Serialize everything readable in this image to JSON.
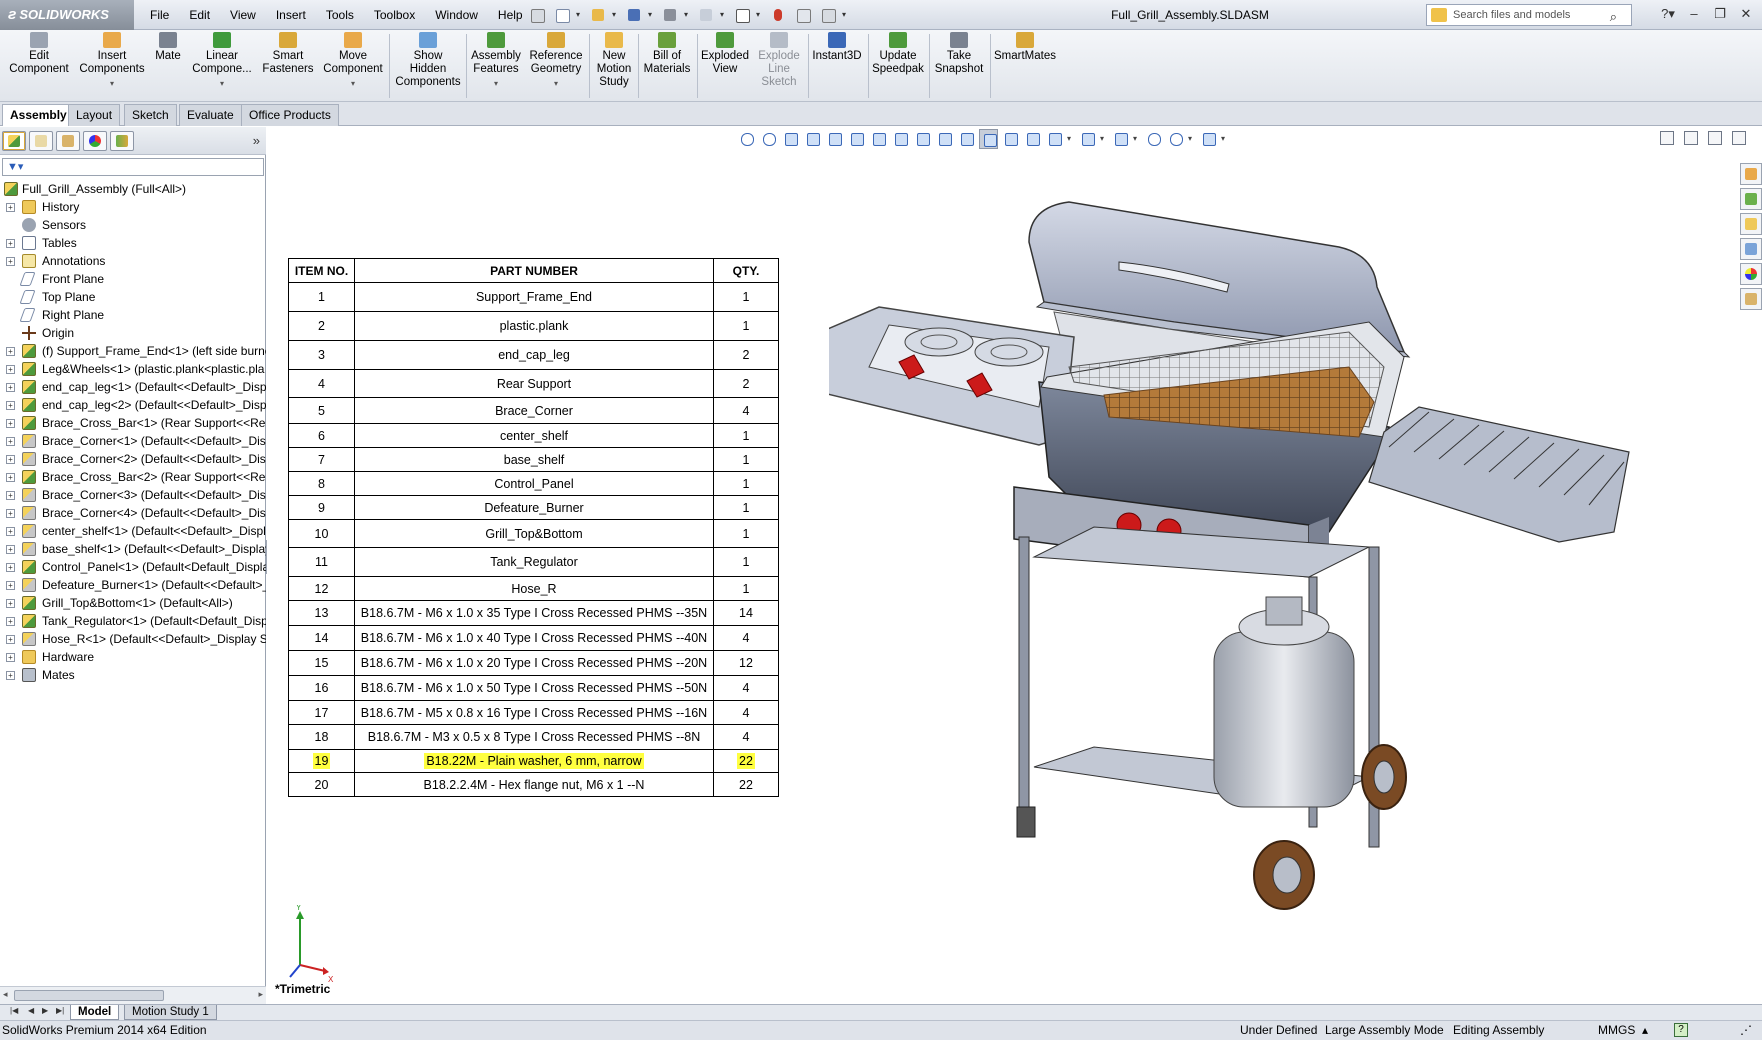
{
  "app": {
    "brand": "SOLIDWORKS",
    "document_title": "Full_Grill_Assembly.SLDASM",
    "search_placeholder": "Search files and models"
  },
  "menu": [
    "File",
    "Edit",
    "View",
    "Insert",
    "Tools",
    "Toolbox",
    "Window",
    "Help"
  ],
  "commands": [
    {
      "id": "edit-component",
      "label1": "Edit",
      "label2": "Component",
      "label3": "",
      "disabled": true,
      "dropdown": false,
      "color": "#9aa3b1"
    },
    {
      "id": "insert-components",
      "label1": "Insert",
      "label2": "Components",
      "label3": "",
      "disabled": false,
      "dropdown": true,
      "color": "#e9a94a"
    },
    {
      "id": "mate",
      "label1": "Mate",
      "label2": "",
      "label3": "",
      "disabled": false,
      "dropdown": false,
      "color": "#7a8290"
    },
    {
      "id": "linear-component",
      "label1": "Linear",
      "label2": "Compone...",
      "label3": "",
      "disabled": false,
      "dropdown": true,
      "color": "#3f9a3c"
    },
    {
      "id": "smart-fasteners",
      "label1": "Smart",
      "label2": "Fasteners",
      "label3": "",
      "disabled": false,
      "dropdown": false,
      "color": "#d9a83a"
    },
    {
      "id": "move-component",
      "label1": "Move",
      "label2": "Component",
      "label3": "",
      "disabled": false,
      "dropdown": true,
      "color": "#e9a94a"
    },
    {
      "id": "show-hidden-components",
      "label1": "Show",
      "label2": "Hidden",
      "label3": "Components",
      "disabled": false,
      "dropdown": false,
      "color": "#6aa0d8"
    },
    {
      "id": "assembly-features",
      "label1": "Assembly",
      "label2": "Features",
      "label3": "",
      "disabled": false,
      "dropdown": true,
      "color": "#4e9a3c"
    },
    {
      "id": "reference-geometry",
      "label1": "Reference",
      "label2": "Geometry",
      "label3": "",
      "disabled": false,
      "dropdown": true,
      "color": "#d9a83a"
    },
    {
      "id": "new-motion-study",
      "label1": "New",
      "label2": "Motion",
      "label3": "Study",
      "disabled": false,
      "dropdown": false,
      "color": "#e9b94a"
    },
    {
      "id": "bill-of-materials",
      "label1": "Bill of",
      "label2": "Materials",
      "label3": "",
      "disabled": false,
      "dropdown": false,
      "color": "#6aa03c"
    },
    {
      "id": "exploded-view",
      "label1": "Exploded",
      "label2": "View",
      "label3": "",
      "disabled": false,
      "dropdown": false,
      "color": "#4e9a3c"
    },
    {
      "id": "explode-line-sketch",
      "label1": "Explode",
      "label2": "Line",
      "label3": "Sketch",
      "disabled": true,
      "dropdown": false,
      "color": "#b5bcc7"
    },
    {
      "id": "instant3d",
      "label1": "Instant3D",
      "label2": "",
      "label3": "",
      "disabled": false,
      "dropdown": false,
      "color": "#3b68b7"
    },
    {
      "id": "update-speedpak",
      "label1": "Update",
      "label2": "Speedpak",
      "label3": "",
      "disabled": false,
      "dropdown": false,
      "color": "#4e9a3c"
    },
    {
      "id": "take-snapshot",
      "label1": "Take",
      "label2": "Snapshot",
      "label3": "",
      "disabled": false,
      "dropdown": false,
      "color": "#7a8290"
    },
    {
      "id": "smartmates",
      "label1": "SmartMates",
      "label2": "",
      "label3": "",
      "disabled": false,
      "dropdown": false,
      "color": "#d9a83a"
    }
  ],
  "tabs": [
    "Assembly",
    "Layout",
    "Sketch",
    "Evaluate",
    "Office Products"
  ],
  "tree": [
    {
      "label": "Full_Grill_Assembly  (Full<All>)",
      "icon": "asm",
      "expander": false,
      "root": true
    },
    {
      "label": "History",
      "icon": "history",
      "expander": true
    },
    {
      "label": "Sensors",
      "icon": "sensor",
      "expander": false
    },
    {
      "label": "Tables",
      "icon": "table",
      "expander": true
    },
    {
      "label": "Annotations",
      "icon": "annot",
      "expander": true
    },
    {
      "label": "Front Plane",
      "icon": "plane",
      "expander": false
    },
    {
      "label": "Top Plane",
      "icon": "plane",
      "expander": false
    },
    {
      "label": "Right Plane",
      "icon": "plane",
      "expander": false
    },
    {
      "label": "Origin",
      "icon": "origin",
      "expander": false
    },
    {
      "label": "(f) Support_Frame_End<1> (left side burner",
      "icon": "asm",
      "expander": true
    },
    {
      "label": "Leg&Wheels<1> (plastic.plank<plastic.pla",
      "icon": "asm",
      "expander": true
    },
    {
      "label": "end_cap_leg<1> (Default<<Default>_Disp",
      "icon": "asm",
      "expander": true
    },
    {
      "label": "end_cap_leg<2> (Default<<Default>_Disp",
      "icon": "asm",
      "expander": true
    },
    {
      "label": "Brace_Cross_Bar<1> (Rear Support<<Rear",
      "icon": "asm",
      "expander": true
    },
    {
      "label": "Brace_Corner<1> (Default<<Default>_Disp",
      "icon": "part",
      "expander": true
    },
    {
      "label": "Brace_Corner<2> (Default<<Default>_Disp",
      "icon": "part",
      "expander": true
    },
    {
      "label": "Brace_Cross_Bar<2> (Rear Support<<Rear",
      "icon": "asm",
      "expander": true
    },
    {
      "label": "Brace_Corner<3> (Default<<Default>_Disp",
      "icon": "part",
      "expander": true
    },
    {
      "label": "Brace_Corner<4> (Default<<Default>_Disp",
      "icon": "part",
      "expander": true
    },
    {
      "label": "center_shelf<1> (Default<<Default>_Displ",
      "icon": "part",
      "expander": true
    },
    {
      "label": "base_shelf<1> (Default<<Default>_Display",
      "icon": "part",
      "expander": true
    },
    {
      "label": "Control_Panel<1> (Default<Default_Displa",
      "icon": "asm",
      "expander": true
    },
    {
      "label": "Defeature_Burner<1> (Default<<Default>_",
      "icon": "part",
      "expander": true
    },
    {
      "label": "Grill_Top&Bottom<1> (Default<All>)",
      "icon": "asm",
      "expander": true
    },
    {
      "label": "Tank_Regulator<1> (Default<Default_Disp",
      "icon": "asm",
      "expander": true
    },
    {
      "label": "Hose_R<1> (Default<<Default>_Display St",
      "icon": "part",
      "expander": true
    },
    {
      "label": "Hardware",
      "icon": "folder",
      "expander": true
    },
    {
      "label": "Mates",
      "icon": "mates",
      "expander": true
    }
  ],
  "bom": {
    "headers": [
      "ITEM NO.",
      "PART NUMBER",
      "QTY."
    ],
    "rows": [
      {
        "item": "1",
        "part": "Support_Frame_End",
        "qty": "1",
        "h": 29
      },
      {
        "item": "2",
        "part": "plastic.plank",
        "qty": "1",
        "h": 29
      },
      {
        "item": "3",
        "part": "end_cap_leg",
        "qty": "2",
        "h": 29
      },
      {
        "item": "4",
        "part": "Rear Support",
        "qty": "2",
        "h": 28
      },
      {
        "item": "5",
        "part": "Brace_Corner",
        "qty": "4",
        "h": 26
      },
      {
        "item": "6",
        "part": "center_shelf",
        "qty": "1",
        "h": 24
      },
      {
        "item": "7",
        "part": "base_shelf",
        "qty": "1",
        "h": 24
      },
      {
        "item": "8",
        "part": "Control_Panel",
        "qty": "1",
        "h": 24
      },
      {
        "item": "9",
        "part": "Defeature_Burner",
        "qty": "1",
        "h": 24
      },
      {
        "item": "10",
        "part": "Grill_Top&Bottom",
        "qty": "1",
        "h": 28
      },
      {
        "item": "11",
        "part": "Tank_Regulator",
        "qty": "1",
        "h": 29
      },
      {
        "item": "12",
        "part": "Hose_R",
        "qty": "1",
        "h": 24
      },
      {
        "item": "13",
        "part": "B18.6.7M - M6 x 1.0 x 35 Type I Cross Recessed PHMS --35N",
        "qty": "14",
        "h": 25
      },
      {
        "item": "14",
        "part": "B18.6.7M - M6 x 1.0 x 40 Type I Cross Recessed PHMS --40N",
        "qty": "4",
        "h": 25
      },
      {
        "item": "15",
        "part": "B18.6.7M - M6 x 1.0 x 20 Type I Cross Recessed PHMS --20N",
        "qty": "12",
        "h": 25
      },
      {
        "item": "16",
        "part": "B18.6.7M - M6 x 1.0 x 50 Type I Cross Recessed PHMS --50N",
        "qty": "4",
        "h": 25
      },
      {
        "item": "17",
        "part": "B18.6.7M - M5 x 0.8 x 16 Type I Cross Recessed PHMS --16N",
        "qty": "4",
        "h": 24
      },
      {
        "item": "18",
        "part": "B18.6.7M - M3 x 0.5 x 8 Type I Cross Recessed PHMS --8N",
        "qty": "4",
        "h": 25
      },
      {
        "item": "19",
        "part": "B18.22M - Plain washer, 6 mm, narrow",
        "qty": "22",
        "h": 23,
        "highlight": true
      },
      {
        "item": "20",
        "part": "B18.2.2.4M - Hex flange nut, M6 x 1 --N",
        "qty": "22",
        "h": 24
      }
    ]
  },
  "viewport": {
    "view_name": "*Trimetric",
    "triad": {
      "x": "X",
      "y": "Y"
    }
  },
  "model_tabs": [
    "Model",
    "Motion Study 1"
  ],
  "status": {
    "edition": "SolidWorks Premium 2014 x64 Edition",
    "state": "Under Defined",
    "mode": "Large Assembly Mode",
    "editing": "Editing Assembly",
    "units": "MMGS",
    "help": "?"
  },
  "colors": {
    "highlight": "#ffff40",
    "grill_body": "#a8b0c4",
    "knob": "#cc1a1a",
    "tank": "#c9cdd6",
    "wheel": "#7a4a24"
  }
}
